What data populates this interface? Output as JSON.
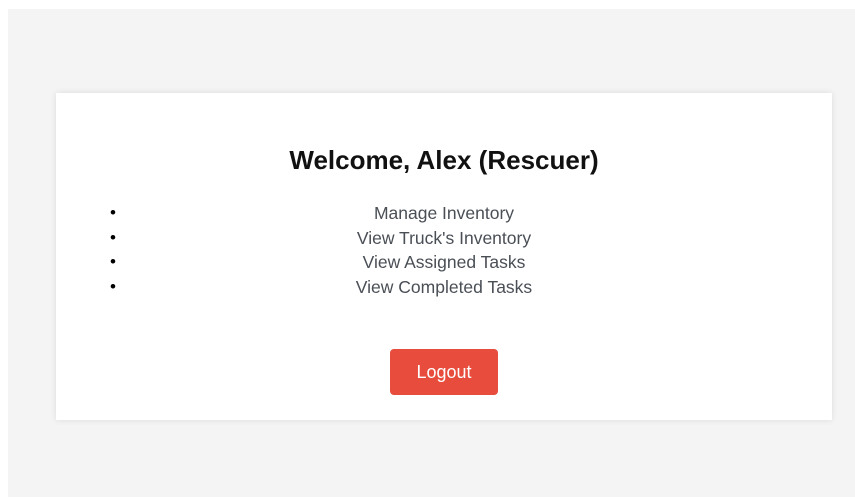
{
  "header": {
    "welcome_text": "Welcome, Alex (Rescuer)"
  },
  "menu": {
    "items": [
      {
        "label": "Manage Inventory"
      },
      {
        "label": "View Truck's Inventory"
      },
      {
        "label": "View Assigned Tasks"
      },
      {
        "label": "View Completed Tasks"
      }
    ],
    "bullet": "•"
  },
  "actions": {
    "logout_label": "Logout"
  },
  "colors": {
    "page_background": "#f4f4f4",
    "card_background": "#ffffff",
    "logout_button": "#e74c3c",
    "link_text": "#4a4f56"
  }
}
